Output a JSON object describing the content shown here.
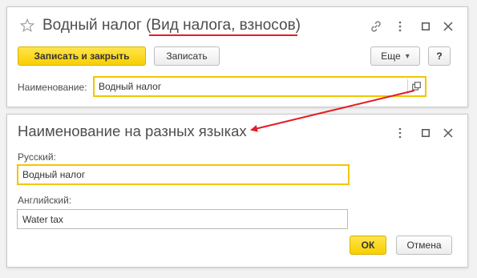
{
  "window_main": {
    "title_prefix": "Водный налог (",
    "title_type": "Вид налога, взносов",
    "title_suffix": ")",
    "toolbar": {
      "save_close_label": "Записать и закрыть",
      "save_label": "Записать",
      "more_label": "Еще",
      "more_arrow": "▾",
      "help_label": "?"
    },
    "name_label": "Наименование:",
    "name_value": "Водный налог",
    "icons": [
      "star-icon",
      "link-icon",
      "more-vertical-icon",
      "maximize-icon",
      "close-icon",
      "open-list-icon"
    ]
  },
  "window_lang": {
    "title": "Наименование на разных языках",
    "russian_label": "Русский:",
    "russian_value": "Водный налог",
    "english_label": "Английский:",
    "english_value": "Water tax",
    "ok_label": "ОК",
    "cancel_label": "Отмена",
    "icons": [
      "more-vertical-icon",
      "maximize-icon",
      "close-icon"
    ]
  },
  "annotation": {
    "underline_color": "#e31e24",
    "arrow_color": "#e31e24"
  },
  "accent_color": "#f7cf00"
}
